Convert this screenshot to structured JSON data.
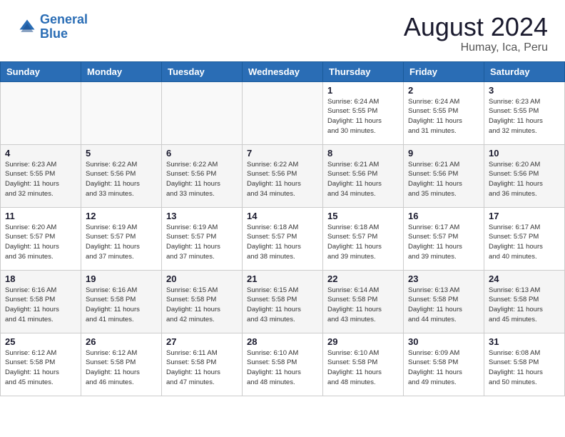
{
  "header": {
    "logo_line1": "General",
    "logo_line2": "Blue",
    "month": "August 2024",
    "location": "Humay, Ica, Peru"
  },
  "days_of_week": [
    "Sunday",
    "Monday",
    "Tuesday",
    "Wednesday",
    "Thursday",
    "Friday",
    "Saturday"
  ],
  "weeks": [
    [
      {
        "day": "",
        "info": ""
      },
      {
        "day": "",
        "info": ""
      },
      {
        "day": "",
        "info": ""
      },
      {
        "day": "",
        "info": ""
      },
      {
        "day": "1",
        "info": "Sunrise: 6:24 AM\nSunset: 5:55 PM\nDaylight: 11 hours\nand 30 minutes."
      },
      {
        "day": "2",
        "info": "Sunrise: 6:24 AM\nSunset: 5:55 PM\nDaylight: 11 hours\nand 31 minutes."
      },
      {
        "day": "3",
        "info": "Sunrise: 6:23 AM\nSunset: 5:55 PM\nDaylight: 11 hours\nand 32 minutes."
      }
    ],
    [
      {
        "day": "4",
        "info": "Sunrise: 6:23 AM\nSunset: 5:55 PM\nDaylight: 11 hours\nand 32 minutes."
      },
      {
        "day": "5",
        "info": "Sunrise: 6:22 AM\nSunset: 5:56 PM\nDaylight: 11 hours\nand 33 minutes."
      },
      {
        "day": "6",
        "info": "Sunrise: 6:22 AM\nSunset: 5:56 PM\nDaylight: 11 hours\nand 33 minutes."
      },
      {
        "day": "7",
        "info": "Sunrise: 6:22 AM\nSunset: 5:56 PM\nDaylight: 11 hours\nand 34 minutes."
      },
      {
        "day": "8",
        "info": "Sunrise: 6:21 AM\nSunset: 5:56 PM\nDaylight: 11 hours\nand 34 minutes."
      },
      {
        "day": "9",
        "info": "Sunrise: 6:21 AM\nSunset: 5:56 PM\nDaylight: 11 hours\nand 35 minutes."
      },
      {
        "day": "10",
        "info": "Sunrise: 6:20 AM\nSunset: 5:56 PM\nDaylight: 11 hours\nand 36 minutes."
      }
    ],
    [
      {
        "day": "11",
        "info": "Sunrise: 6:20 AM\nSunset: 5:57 PM\nDaylight: 11 hours\nand 36 minutes."
      },
      {
        "day": "12",
        "info": "Sunrise: 6:19 AM\nSunset: 5:57 PM\nDaylight: 11 hours\nand 37 minutes."
      },
      {
        "day": "13",
        "info": "Sunrise: 6:19 AM\nSunset: 5:57 PM\nDaylight: 11 hours\nand 37 minutes."
      },
      {
        "day": "14",
        "info": "Sunrise: 6:18 AM\nSunset: 5:57 PM\nDaylight: 11 hours\nand 38 minutes."
      },
      {
        "day": "15",
        "info": "Sunrise: 6:18 AM\nSunset: 5:57 PM\nDaylight: 11 hours\nand 39 minutes."
      },
      {
        "day": "16",
        "info": "Sunrise: 6:17 AM\nSunset: 5:57 PM\nDaylight: 11 hours\nand 39 minutes."
      },
      {
        "day": "17",
        "info": "Sunrise: 6:17 AM\nSunset: 5:57 PM\nDaylight: 11 hours\nand 40 minutes."
      }
    ],
    [
      {
        "day": "18",
        "info": "Sunrise: 6:16 AM\nSunset: 5:58 PM\nDaylight: 11 hours\nand 41 minutes."
      },
      {
        "day": "19",
        "info": "Sunrise: 6:16 AM\nSunset: 5:58 PM\nDaylight: 11 hours\nand 41 minutes."
      },
      {
        "day": "20",
        "info": "Sunrise: 6:15 AM\nSunset: 5:58 PM\nDaylight: 11 hours\nand 42 minutes."
      },
      {
        "day": "21",
        "info": "Sunrise: 6:15 AM\nSunset: 5:58 PM\nDaylight: 11 hours\nand 43 minutes."
      },
      {
        "day": "22",
        "info": "Sunrise: 6:14 AM\nSunset: 5:58 PM\nDaylight: 11 hours\nand 43 minutes."
      },
      {
        "day": "23",
        "info": "Sunrise: 6:13 AM\nSunset: 5:58 PM\nDaylight: 11 hours\nand 44 minutes."
      },
      {
        "day": "24",
        "info": "Sunrise: 6:13 AM\nSunset: 5:58 PM\nDaylight: 11 hours\nand 45 minutes."
      }
    ],
    [
      {
        "day": "25",
        "info": "Sunrise: 6:12 AM\nSunset: 5:58 PM\nDaylight: 11 hours\nand 45 minutes."
      },
      {
        "day": "26",
        "info": "Sunrise: 6:12 AM\nSunset: 5:58 PM\nDaylight: 11 hours\nand 46 minutes."
      },
      {
        "day": "27",
        "info": "Sunrise: 6:11 AM\nSunset: 5:58 PM\nDaylight: 11 hours\nand 47 minutes."
      },
      {
        "day": "28",
        "info": "Sunrise: 6:10 AM\nSunset: 5:58 PM\nDaylight: 11 hours\nand 48 minutes."
      },
      {
        "day": "29",
        "info": "Sunrise: 6:10 AM\nSunset: 5:58 PM\nDaylight: 11 hours\nand 48 minutes."
      },
      {
        "day": "30",
        "info": "Sunrise: 6:09 AM\nSunset: 5:58 PM\nDaylight: 11 hours\nand 49 minutes."
      },
      {
        "day": "31",
        "info": "Sunrise: 6:08 AM\nSunset: 5:58 PM\nDaylight: 11 hours\nand 50 minutes."
      }
    ]
  ]
}
